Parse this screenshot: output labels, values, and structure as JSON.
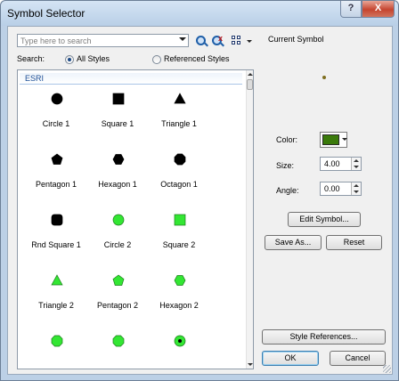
{
  "window": {
    "title": "Symbol Selector",
    "help_label": "?",
    "close_label": "X"
  },
  "search": {
    "placeholder": "Type here to search",
    "label": "Search:",
    "options": [
      "All Styles",
      "Referenced Styles"
    ],
    "selected": "All Styles"
  },
  "list": {
    "group": "ESRI",
    "symbols": [
      {
        "name": "Circle 1",
        "shape": "circle",
        "color": "#000000"
      },
      {
        "name": "Square 1",
        "shape": "square",
        "color": "#000000"
      },
      {
        "name": "Triangle 1",
        "shape": "triangle",
        "color": "#000000"
      },
      {
        "name": "Pentagon 1",
        "shape": "pentagon",
        "color": "#000000"
      },
      {
        "name": "Hexagon 1",
        "shape": "hexagon",
        "color": "#000000"
      },
      {
        "name": "Octagon 1",
        "shape": "octagon",
        "color": "#000000"
      },
      {
        "name": "Rnd Square 1",
        "shape": "rounded-square",
        "color": "#000000"
      },
      {
        "name": "Circle 2",
        "shape": "circle",
        "color": "#33e633"
      },
      {
        "name": "Square 2",
        "shape": "square",
        "color": "#33e633"
      },
      {
        "name": "Triangle 2",
        "shape": "triangle",
        "color": "#33e633"
      },
      {
        "name": "Pentagon 2",
        "shape": "pentagon",
        "color": "#33e633"
      },
      {
        "name": "Hexagon 2",
        "shape": "hexagon",
        "color": "#33e633"
      },
      {
        "name": "",
        "shape": "octagon",
        "color": "#33e633"
      },
      {
        "name": "",
        "shape": "octagon",
        "color": "#33e633"
      },
      {
        "name": "",
        "shape": "circle-dot",
        "color": "#33e633"
      }
    ]
  },
  "current_symbol": {
    "title": "Current Symbol",
    "color_label": "Color:",
    "color_value": "#3a7a0a",
    "size_label": "Size:",
    "size_value": "4.00",
    "angle_label": "Angle:",
    "angle_value": "0.00"
  },
  "buttons": {
    "edit_symbol": "Edit Symbol...",
    "save_as": "Save As...",
    "reset": "Reset",
    "style_references": "Style References...",
    "ok": "OK",
    "cancel": "Cancel"
  }
}
